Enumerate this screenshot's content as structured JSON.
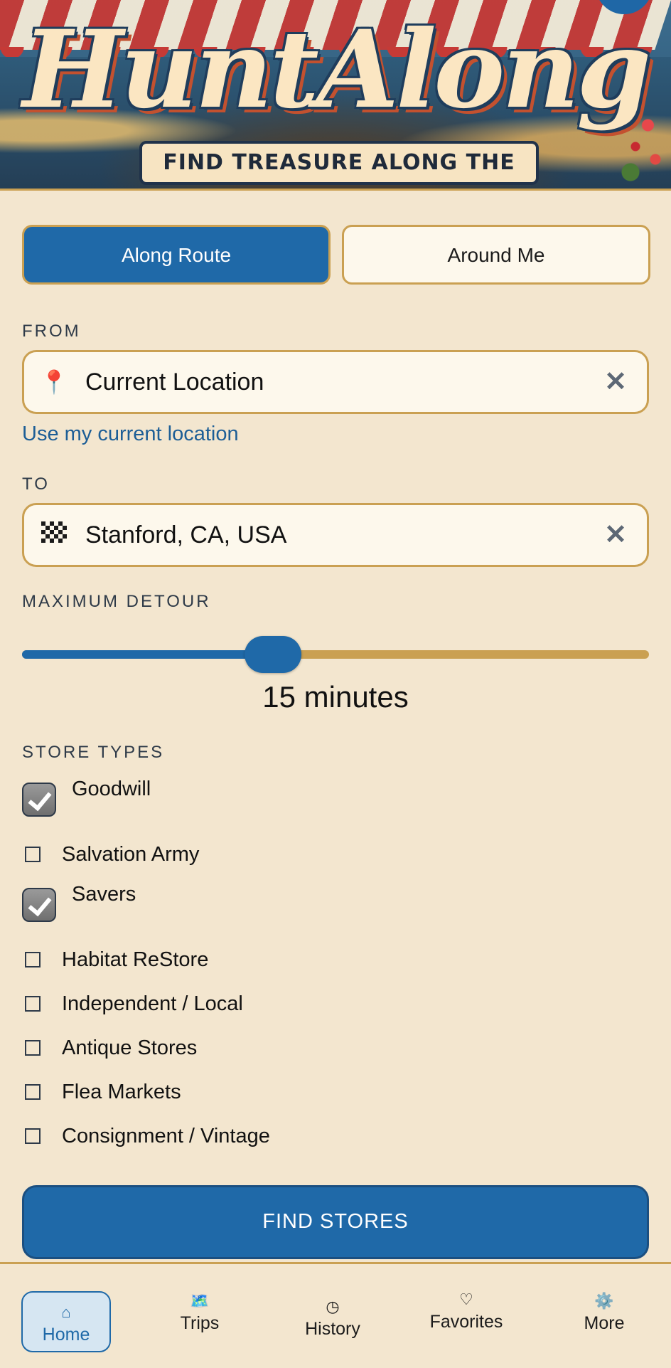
{
  "banner": {
    "title": "HuntAlong",
    "tagline": "FIND TREASURE ALONG THE WAY."
  },
  "mode_toggle": {
    "options": [
      "Along Route",
      "Around Me"
    ],
    "selected": "Along Route"
  },
  "from": {
    "label": "FROM",
    "icon": "pin-icon",
    "value": "Current Location",
    "use_location_link": "Use my current location"
  },
  "to": {
    "label": "TO",
    "icon": "checkered-flag-icon",
    "value": "Stanford, CA, USA"
  },
  "detour": {
    "label": "MAXIMUM DETOUR",
    "value_text": "15 minutes",
    "fraction": 0.4
  },
  "store_types": {
    "label": "STORE TYPES",
    "items": [
      {
        "label": "Goodwill",
        "checked": true
      },
      {
        "label": "Salvation Army",
        "checked": false
      },
      {
        "label": "Savers",
        "checked": true
      },
      {
        "label": "Habitat ReStore",
        "checked": false
      },
      {
        "label": "Independent / Local",
        "checked": false
      },
      {
        "label": "Antique Stores",
        "checked": false
      },
      {
        "label": "Flea Markets",
        "checked": false
      },
      {
        "label": "Consignment / Vintage",
        "checked": false
      }
    ]
  },
  "find_button": "FIND STORES",
  "nav": {
    "items": [
      {
        "label": "Home",
        "icon": "home-icon",
        "glyph": "⌂",
        "active": true
      },
      {
        "label": "Trips",
        "icon": "map-icon",
        "glyph": "🗺️",
        "active": false
      },
      {
        "label": "History",
        "icon": "clock-icon",
        "glyph": "◷",
        "active": false
      },
      {
        "label": "Favorites",
        "icon": "heart-icon",
        "glyph": "♡",
        "active": false
      },
      {
        "label": "More",
        "icon": "gear-icon",
        "glyph": "⚙️",
        "active": false
      }
    ]
  },
  "colors": {
    "background": "#f3e6cf",
    "primary": "#1f69a8",
    "accent": "#caa052",
    "field_bg": "#fdf8ec"
  }
}
